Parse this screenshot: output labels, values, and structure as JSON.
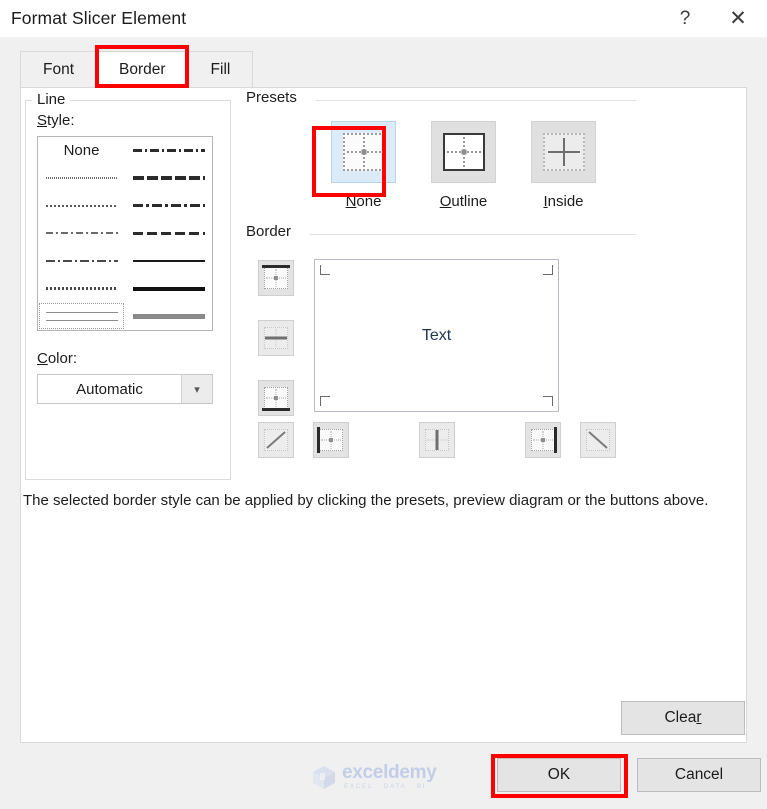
{
  "window": {
    "title": "Format Slicer Element",
    "help_icon": "question-mark-icon",
    "close_icon": "close-x-icon"
  },
  "tabs": [
    {
      "label": "Font",
      "active": false
    },
    {
      "label": "Border",
      "active": true
    },
    {
      "label": "Fill",
      "active": false
    }
  ],
  "line_group": {
    "title": "Line",
    "style_label": "Style:",
    "none_label": "None",
    "color_label": "Color:",
    "color_value": "Automatic",
    "color_dropdown_icon": "chevron-down-icon",
    "styles_left": [
      "none",
      "fine-dotted",
      "dotted",
      "dash-dot-light",
      "dash-dot",
      "dotted-medium",
      "double-line"
    ],
    "styles_right": [
      "dash-dot-dot",
      "slanted-dash",
      "dash-dot-thick",
      "dashed",
      "thin-solid",
      "thick-solid",
      "gray-thick"
    ],
    "selected_style": "double-line"
  },
  "presets": {
    "title": "Presets",
    "items": [
      {
        "label": "None",
        "accel": "N",
        "icon": "preset-none-icon",
        "selected": true
      },
      {
        "label": "Outline",
        "accel": "O",
        "icon": "preset-outline-icon",
        "selected": false
      },
      {
        "label": "Inside",
        "accel": "I",
        "icon": "preset-inside-icon",
        "selected": false
      }
    ]
  },
  "border": {
    "title": "Border",
    "preview_text": "Text",
    "left_buttons": [
      {
        "name": "border-top-button",
        "icon": "border-top-icon"
      },
      {
        "name": "border-horizontal-button",
        "icon": "border-middle-horizontal-icon"
      },
      {
        "name": "border-bottom-button",
        "icon": "border-bottom-icon"
      }
    ],
    "bottom_buttons": [
      {
        "name": "border-diagonal-up-button",
        "icon": "border-diagonal-up-icon"
      },
      {
        "name": "border-left-button",
        "icon": "border-left-icon"
      },
      {
        "name": "border-vertical-button",
        "icon": "border-middle-vertical-icon"
      },
      {
        "name": "border-right-button",
        "icon": "border-right-icon"
      },
      {
        "name": "border-diagonal-down-button",
        "icon": "border-diagonal-down-icon"
      }
    ]
  },
  "help_text": "The selected border style can be applied by clicking the presets, preview diagram or the buttons above.",
  "buttons": {
    "clear": "Clear",
    "clear_accel": "r",
    "ok": "OK",
    "cancel": "Cancel"
  },
  "watermark": {
    "name": "exceldemy",
    "tagline": "EXCEL · DATA · BI"
  },
  "colors": {
    "annotation_red": "#ff0000",
    "selected_preset_bg": "#dcebf8",
    "dialog_bg": "#f0f0f0",
    "panel_bg": "#ffffff",
    "button_face": "#e4e4e4"
  }
}
